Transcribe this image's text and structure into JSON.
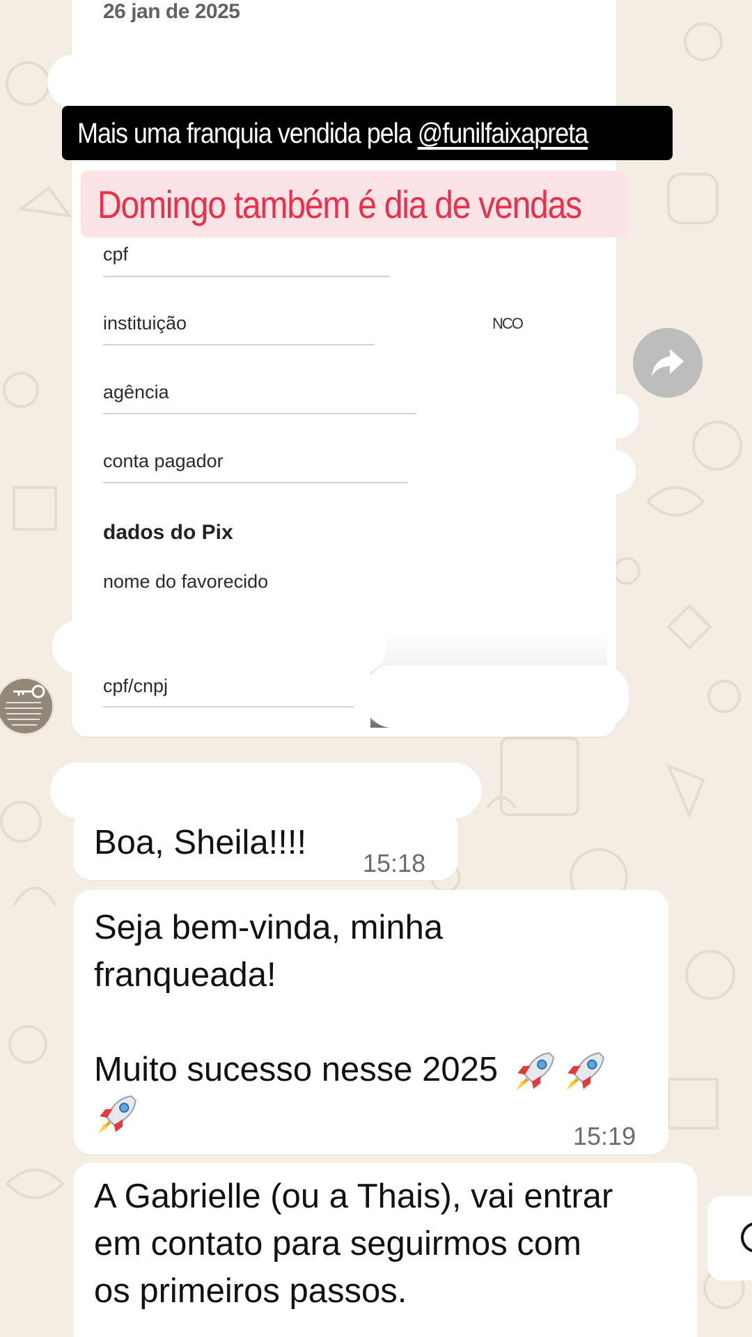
{
  "receipt": {
    "date": "26 jan de 2025",
    "fields": {
      "cpf": "cpf",
      "instituicao": "instituição",
      "instituicao_value": "NCO",
      "agencia": "agência",
      "conta_pagador": "conta pagador",
      "dados_pix": "dados do Pix",
      "nome_favorecido": "nome do favorecido",
      "cpf_cnpj": "cpf/cnpj"
    }
  },
  "story": {
    "caption_prefix": "Mais uma franquia vendida pela ",
    "caption_handle": "@funilfaixapreta",
    "headline": "Domingo também é dia de vendas"
  },
  "messages": [
    {
      "text": "Boa, Sheila!!!!",
      "time": "15:18"
    },
    {
      "text": "Seja bem-vinda, minha\nfranqueada!\n\nMuito sucesso nesse 2025",
      "time": "15:19",
      "emoji": "rocket"
    },
    {
      "text": "A Gabrielle (ou a Thais), vai entrar\nem contato para seguirmos com\nos primeiros passos."
    }
  ],
  "colors": {
    "chat_background": "#f3ede3",
    "headline_text": "#e8314a",
    "headline_background": "#fbe3e6",
    "caption_background": "#000000"
  },
  "icons": [
    "forward-icon",
    "rocket-emoji-icon",
    "avatar"
  ]
}
